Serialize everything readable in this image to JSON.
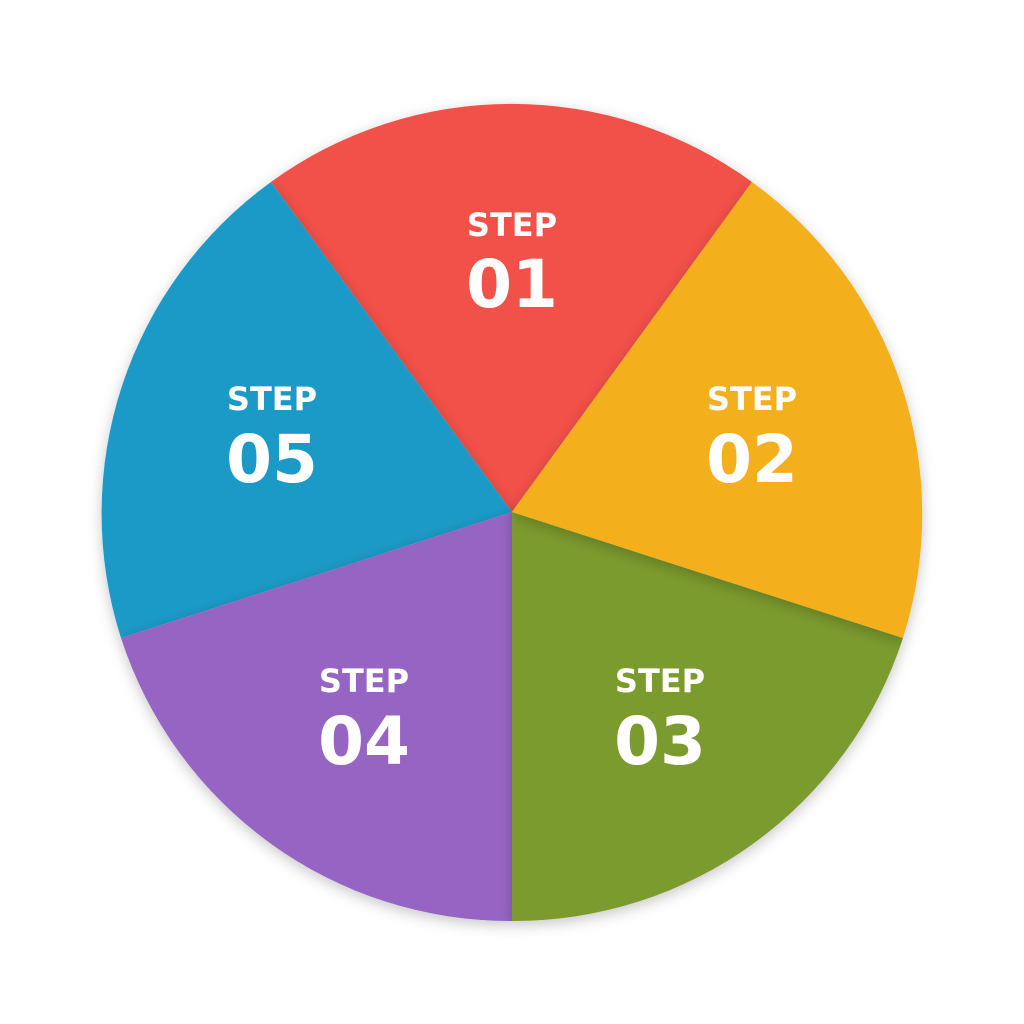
{
  "segments": [
    {
      "label": "STEP",
      "number": "01",
      "color": "#F2514A"
    },
    {
      "label": "STEP",
      "number": "02",
      "color": "#F3AF1C"
    },
    {
      "label": "STEP",
      "number": "03",
      "color": "#7C9B2F"
    },
    {
      "label": "STEP",
      "number": "04",
      "color": "#9665C4"
    },
    {
      "label": "STEP",
      "number": "05",
      "color": "#1F9AC7"
    }
  ]
}
